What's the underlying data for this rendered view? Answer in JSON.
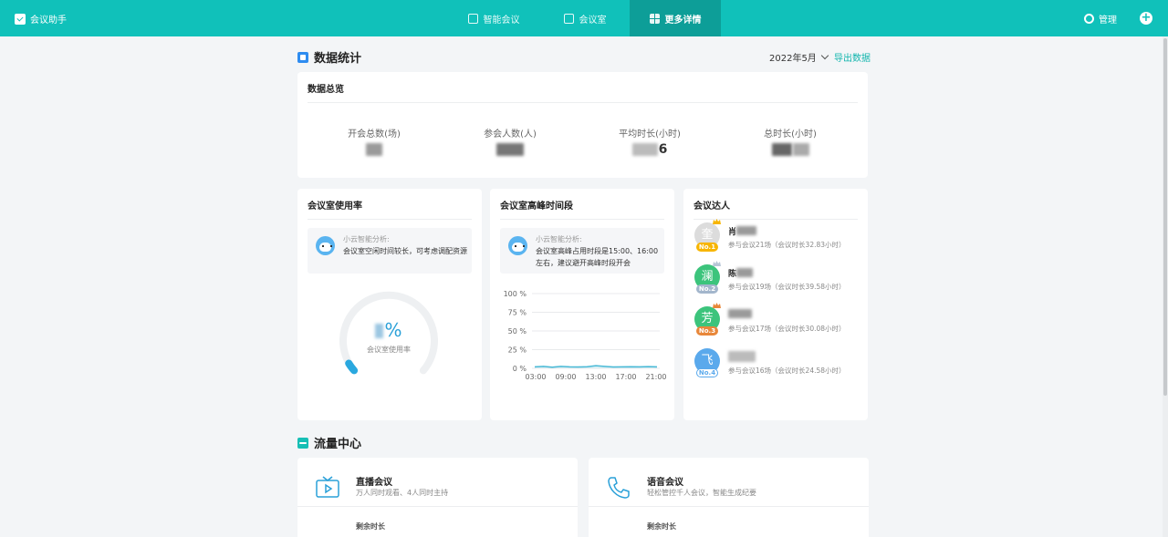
{
  "topbar": {
    "brand": "会议助手",
    "nav": [
      {
        "label": "智能会议",
        "active": false,
        "icon": "smart-meeting-icon"
      },
      {
        "label": "会议室",
        "active": false,
        "icon": "meeting-room-icon"
      },
      {
        "label": "更多详情",
        "active": true,
        "icon": "grid-icon"
      }
    ],
    "manage_label": "管理",
    "add_icon": "plus-icon",
    "bg_color": "#10c1ba",
    "active_color": "#0d9e98"
  },
  "stats_section": {
    "title": "数据统计",
    "month": "2022年5月",
    "export_label": "导出数据"
  },
  "overview": {
    "title": "数据总览",
    "items": [
      {
        "label": "开会总数(场)"
      },
      {
        "label": "参会人数(人)"
      },
      {
        "label": "平均时长(小时)",
        "value_visible": "6"
      },
      {
        "label": "总时长(小时)"
      }
    ]
  },
  "room_usage": {
    "title": "会议室使用率",
    "ai_title": "小云智能分析:",
    "ai_text": "会议室空闲时间较长，可考虑调配资源",
    "gauge_unit": "%",
    "gauge_label": "会议室使用率"
  },
  "peak": {
    "title": "会议室高峰时间段",
    "ai_title": "小云智能分析:",
    "ai_text": "会议室高峰占用时段是15:00、16:00左右，建议避开高峰时段开会"
  },
  "chart_data": {
    "type": "area",
    "x": [
      "03:00",
      "09:00",
      "13:00",
      "17:00",
      "21:00"
    ],
    "y_ticks": [
      "100 %",
      "75 %",
      "50 %",
      "25 %",
      "0 %"
    ],
    "ylim": [
      0,
      100
    ],
    "series": [
      {
        "values": [
          2,
          2.5,
          1.5,
          2.5,
          2,
          1.8,
          2.2,
          3.5,
          2.5,
          1.8,
          2,
          2.2,
          2,
          2.3,
          2
        ]
      }
    ],
    "color": "#49b9d6"
  },
  "experts": {
    "title": "会议达人",
    "people": [
      {
        "avatar_char": "奎",
        "name": "肖",
        "info": "参与会议21场（会议时长32.83小时）",
        "rank": "No.1",
        "avatar_color": "#dcdcdc",
        "badge_color": "#f7b500"
      },
      {
        "avatar_char": "澜",
        "name": "陈",
        "info": "参与会议19场（会议时长39.58小时）",
        "rank": "No.2",
        "avatar_color": "#3cc47c",
        "badge_color": "#a3b6cc"
      },
      {
        "avatar_char": "芳",
        "name": "",
        "info": "参与会议17场（会议时长30.08小时）",
        "rank": "No.3",
        "avatar_color": "#3cc47c",
        "badge_color": "#e8873a"
      },
      {
        "avatar_char": "飞",
        "name": "",
        "info": "参与会议16场（会议时长24.58小时）",
        "rank": "No.4",
        "avatar_color": "#5aa9ec",
        "badge_color": "#ffffff"
      }
    ]
  },
  "flow_section": {
    "title": "流量中心",
    "cards": [
      {
        "title": "直播会议",
        "sub": "万人同时观看、4人同时主持",
        "remain_label": "剩余时长",
        "icon": "live-broadcast-icon"
      },
      {
        "title": "语音会议",
        "sub": "轻松管控千人会议，智能生成纪要",
        "remain_label": "剩余时长",
        "icon": "phone-icon"
      }
    ]
  }
}
